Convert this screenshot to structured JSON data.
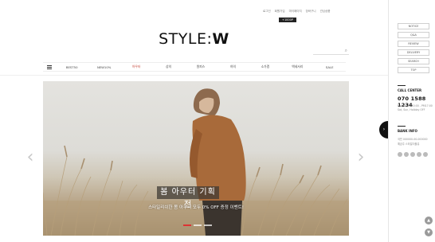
{
  "header": {
    "util_links": [
      "로그인",
      "회원가입",
      "마이페이지",
      "장바구니",
      "관심상품"
    ],
    "badge": "+1000P",
    "logo_prefix": "STYLE:",
    "logo_suffix": "W",
    "search_placeholder": ""
  },
  "nav": {
    "items": [
      "BEST50",
      "NEW10%",
      "아우터",
      "상의",
      "원피스",
      "하의",
      "소가겠",
      "액세서리",
      "SALE"
    ],
    "accent_color": "#c0392b"
  },
  "hero": {
    "title": "봄 아우터 기획전",
    "subtitle": "스타일리쉬한 봄 아우터 모두 0% OFF 증정 이벤트!",
    "slide_count": 3,
    "active_slide": 0
  },
  "side": {
    "buttons": [
      "NOTICE",
      "Q&A",
      "REVIEW",
      "DELIVERY",
      "SEARCH",
      "TOP"
    ],
    "call_center_title": "CALL CENTER",
    "phone": "070 1588 1234",
    "call_hours": "Mon-Fri AM10:00 - PM17:00",
    "call_note": "Sat, Sun, Holiday OFF",
    "bank_title": "BANK INFO",
    "bank_lines": [
      "국민 000000-00-000000",
      "예금주 스타일더블유"
    ],
    "toggle_glyph": "›",
    "scroll_up": "▲",
    "scroll_down": "▼"
  },
  "arrows": {
    "prev": "‹",
    "next": "›"
  },
  "colors": {
    "badge_bg": "#222222",
    "active_dot": "#dd3333",
    "side_toggle": "#111111"
  }
}
